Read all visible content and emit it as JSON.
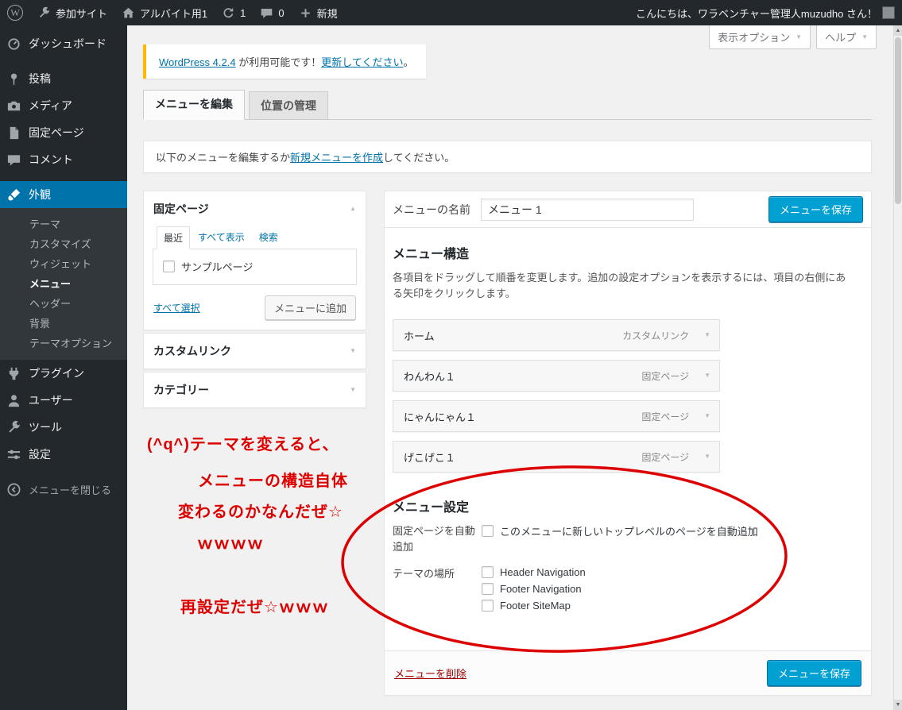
{
  "colors": {
    "accent": "#0073aa",
    "primary_button": "#00a0d2",
    "annotation_red": "#dd0000",
    "notice_accent": "#ffba00",
    "admin_dark": "#23282d"
  },
  "icons": {
    "wordpress_logo": "W",
    "caret_down": "▼",
    "caret_up": "▲"
  },
  "admin_bar": {
    "site_link_label": "参加サイト",
    "current_site_label": "アルバイト用1",
    "updates_count": "1",
    "comments_count": "0",
    "new_label": "新規",
    "greeting": "こんにちは、ワラベンチャー管理人muzudho さん！"
  },
  "sidebar": {
    "items": [
      {
        "label": "ダッシュボード"
      },
      {
        "label": "投稿"
      },
      {
        "label": "メディア"
      },
      {
        "label": "固定ページ"
      },
      {
        "label": "コメント"
      },
      {
        "label": "外観"
      },
      {
        "label": "プラグイン"
      },
      {
        "label": "ユーザー"
      },
      {
        "label": "ツール"
      },
      {
        "label": "設定"
      },
      {
        "label": "メニューを閉じる"
      }
    ],
    "appearance_submenu": [
      {
        "label": "テーマ"
      },
      {
        "label": "カスタマイズ"
      },
      {
        "label": "ウィジェット"
      },
      {
        "label": "メニュー",
        "current": true
      },
      {
        "label": "ヘッダー"
      },
      {
        "label": "背景"
      },
      {
        "label": "テーマオプション"
      }
    ]
  },
  "screen_meta": {
    "screen_options_label": "表示オプション",
    "help_label": "ヘルプ"
  },
  "update_notice": {
    "version_link": "WordPress 4.2.4",
    "available_text": " が利用可能です！",
    "update_link": "更新してください",
    "period": "。"
  },
  "tabs": {
    "edit_menus": "メニューを編集",
    "manage_locations": "位置の管理"
  },
  "manage_menus_bar": {
    "text_before": "以下のメニューを編集するか",
    "create_link": "新規メニューを作成",
    "text_after": "してください。"
  },
  "pages_panel": {
    "title": "固定ページ",
    "tab_recent": "最近",
    "tab_view_all": "すべて表示",
    "tab_search": "検索",
    "page_item": "サンプルページ",
    "select_all_link": "すべて選択",
    "add_to_menu_button": "メニューに追加"
  },
  "custom_links_panel": {
    "title": "カスタムリンク"
  },
  "categories_panel": {
    "title": "カテゴリー"
  },
  "annotations": {
    "line1": "(^q^)テーマを変えると、",
    "line2": "メニューの構造自体",
    "line3": "変わるのかなんだぜ☆",
    "line4": "ｗｗｗｗ",
    "line5": "再設定だぜ☆ｗｗｗ"
  },
  "menu_editor": {
    "name_label": "メニューの名前",
    "name_value": "メニュー 1",
    "save_button": "メニューを保存",
    "structure_heading": "メニュー構造",
    "structure_help": "各項目をドラッグして順番を変更します。追加の設定オプションを表示するには、項目の右側にある矢印をクリックします。",
    "items": [
      {
        "label": "ホーム",
        "type": "カスタムリンク"
      },
      {
        "label": "わんわん１",
        "type": "固定ページ"
      },
      {
        "label": "にゃんにゃん１",
        "type": "固定ページ"
      },
      {
        "label": "げこげこ１",
        "type": "固定ページ"
      }
    ],
    "settings_heading": "メニュー設定",
    "auto_add_label": "固定ページを自動追加",
    "auto_add_checkbox_text": "このメニューに新しいトップレベルのページを自動追加",
    "theme_locations_label": "テーマの場所",
    "locations": [
      {
        "label": "Header Navigation"
      },
      {
        "label": "Footer Navigation"
      },
      {
        "label": "Footer SiteMap"
      }
    ],
    "delete_link": "メニューを削除",
    "save_button_bottom": "メニューを保存"
  }
}
